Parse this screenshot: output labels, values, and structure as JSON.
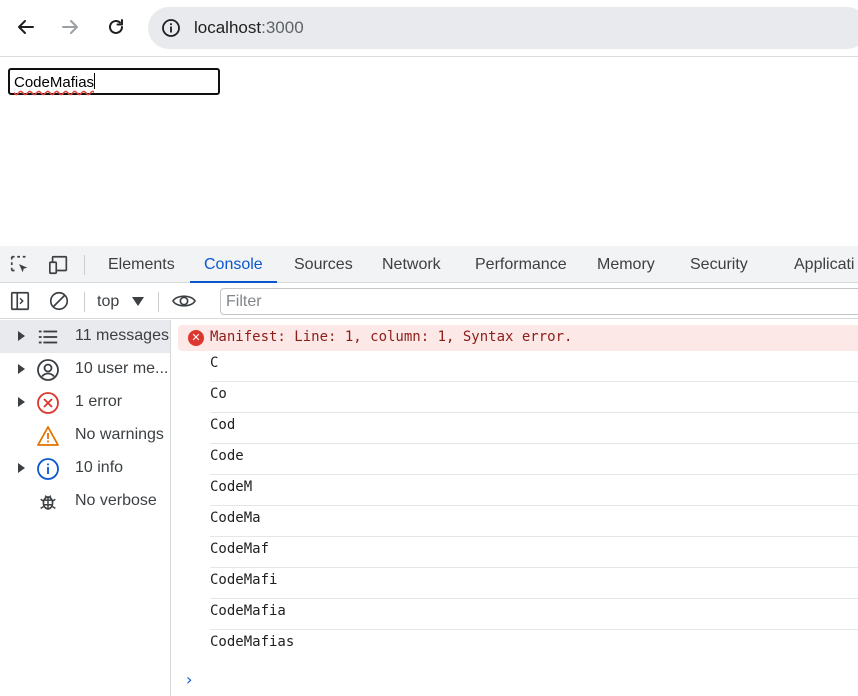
{
  "browser": {
    "url_host": "localhost",
    "url_port": ":3000",
    "icons": {
      "back": "arrow-left-icon",
      "forward": "arrow-right-icon",
      "reload": "reload-icon",
      "site_info": "info-icon"
    }
  },
  "page": {
    "input_value": "CodeMafias"
  },
  "devtools": {
    "tabs": [
      "Elements",
      "Console",
      "Sources",
      "Network",
      "Performance",
      "Memory",
      "Security",
      "Applicati"
    ],
    "active_tab": "Console",
    "context": "top",
    "filter_placeholder": "Filter",
    "sidebar": [
      {
        "label": "11 messages",
        "icon": "list-icon",
        "expandable": true,
        "selected": true
      },
      {
        "label": "10 user me...",
        "icon": "user-icon",
        "expandable": true,
        "selected": false
      },
      {
        "label": "1 error",
        "icon": "error-icon",
        "expandable": true,
        "selected": false
      },
      {
        "label": "No warnings",
        "icon": "warning-icon",
        "expandable": false,
        "selected": false
      },
      {
        "label": "10 info",
        "icon": "info-icon",
        "expandable": true,
        "selected": false
      },
      {
        "label": "No verbose",
        "icon": "bug-icon",
        "expandable": false,
        "selected": false
      }
    ],
    "error_message": "Manifest: Line: 1, column: 1, Syntax error.",
    "logs": [
      "C",
      "Co",
      "Cod",
      "Code",
      "CodeM",
      "CodeMa",
      "CodeMaf",
      "CodeMafi",
      "CodeMafia",
      "CodeMafias"
    ],
    "colors": {
      "accent": "#0b57d0",
      "error_bg": "#fce8e6",
      "error_text": "#8c1d18",
      "error_icon": "#dc362e"
    }
  }
}
